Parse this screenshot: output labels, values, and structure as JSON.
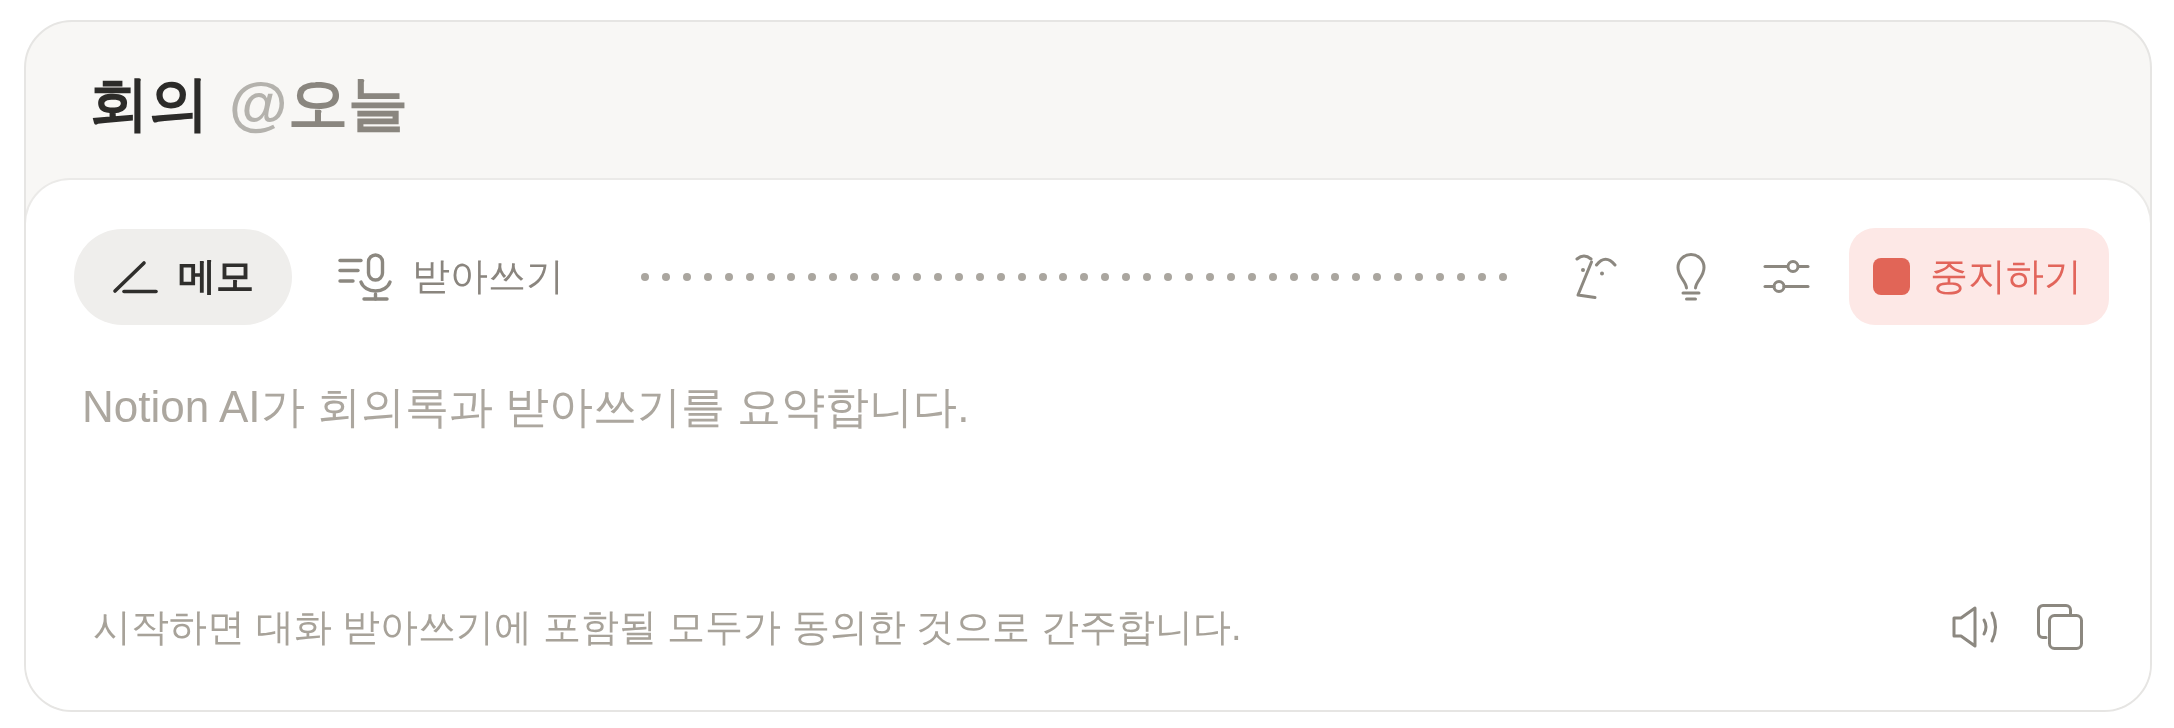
{
  "title": {
    "text": "회의",
    "mention": {
      "prefix": "@",
      "label": "오늘"
    }
  },
  "tabs": [
    {
      "kind": "notes",
      "label": "메모",
      "selected": true
    },
    {
      "kind": "transcript",
      "label": "받아쓰기",
      "selected": false
    }
  ],
  "stop_button": {
    "label": "중지하기"
  },
  "notes": {
    "placeholder": "Notion AI가 회의록과 받아쓰기를 요약합니다."
  },
  "footer": {
    "consent_text": "시작하면 대화 받아쓰기에 포함될 모두가 동의한 것으로 간주합니다."
  }
}
